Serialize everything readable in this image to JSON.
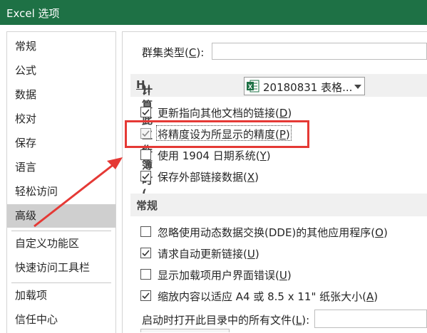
{
  "window": {
    "title": "Excel 选项"
  },
  "sidebar": {
    "items": [
      {
        "label": "常规"
      },
      {
        "label": "公式"
      },
      {
        "label": "数据"
      },
      {
        "label": "校对"
      },
      {
        "label": "保存"
      },
      {
        "label": "语言"
      },
      {
        "label": "轻松访问"
      },
      {
        "label": "高级",
        "active": true
      },
      {
        "label": "自定义功能区"
      },
      {
        "label": "快速访问工具栏"
      },
      {
        "label": "加载项"
      },
      {
        "label": "信任中心"
      }
    ]
  },
  "panel": {
    "group_type": {
      "label": "群集类型(",
      "key": "C",
      "suffix": "):"
    },
    "section_workbook": {
      "label": "计算此工作簿时(",
      "key": "H",
      "suffix": "):",
      "dropdown_value": "20180831 表格..."
    },
    "options_workbook": [
      {
        "text": "更新指向其他文档的链接(",
        "key": "D",
        "end": ")",
        "checked": true,
        "disabled": false
      },
      {
        "text": "将精度设为所显示的精度(",
        "key": "P",
        "end": ")",
        "checked": true,
        "disabled": true
      },
      {
        "text": "使用 1904 日期系统(",
        "key": "Y",
        "end": ")",
        "checked": false,
        "disabled": false
      },
      {
        "text": "保存外部链接数据(",
        "key": "X",
        "end": ")",
        "checked": true,
        "disabled": false
      }
    ],
    "section_general": {
      "label": "常规"
    },
    "options_general": [
      {
        "text": "忽略使用动态数据交换(DDE)的其他应用程序(",
        "key": "O",
        "end": ")",
        "checked": false
      },
      {
        "text": "请求自动更新链接(",
        "key": "U",
        "end": ")",
        "checked": true
      },
      {
        "text": "显示加载项用户界面错误(",
        "key": "U",
        "end": ")",
        "checked": false
      },
      {
        "text": "缩放内容以适应 A4 或 8.5 x 11\" 纸张大小(",
        "key": "A",
        "end": ")",
        "checked": true
      }
    ],
    "startup": {
      "label": "启动时打开此目录中的所有文件(",
      "key": "L",
      "end": "):"
    }
  },
  "colors": {
    "titlebar": "#1e7145",
    "annotation": "#e53935",
    "active_item": "#cfcfcf"
  }
}
